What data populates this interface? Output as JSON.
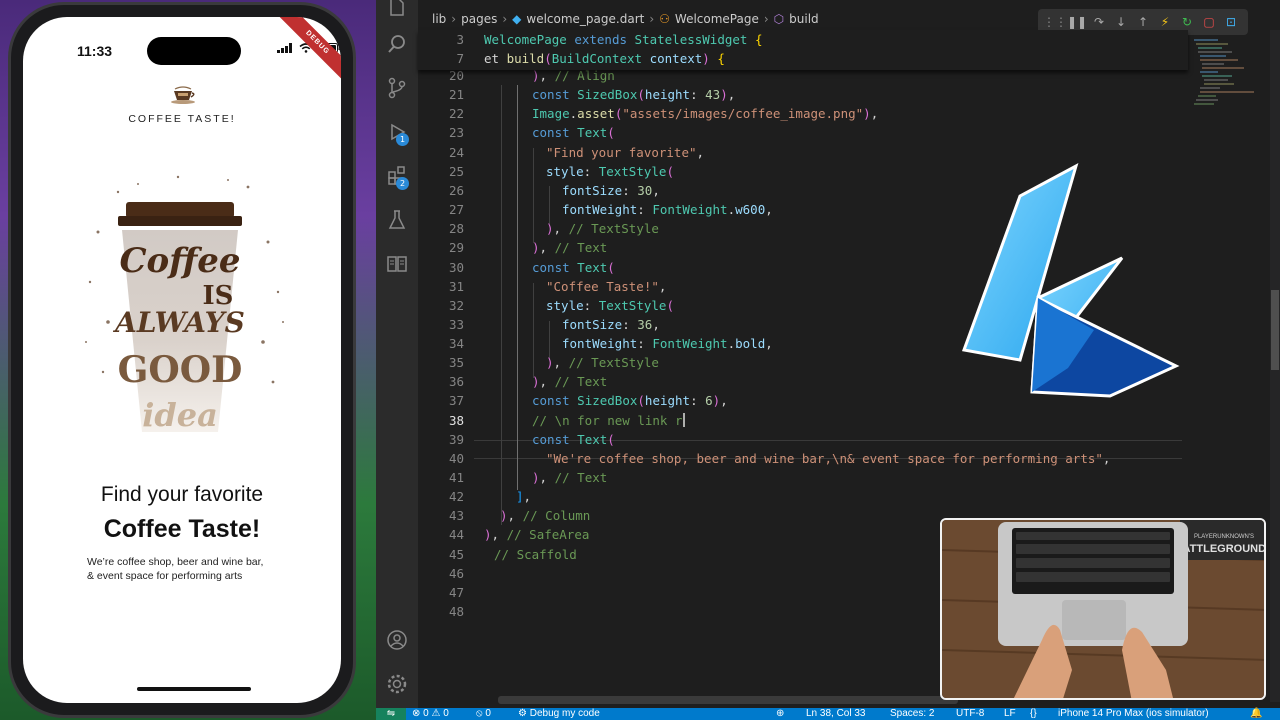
{
  "phone": {
    "time": "11:33",
    "debug_ribbon": "DEBUG",
    "brand": "COFFEE TASTE!",
    "heading_1": "Find your favorite",
    "heading_2": "Coffee Taste!",
    "subtitle_1": "We’re coffee shop, beer and wine bar,",
    "subtitle_2": "& event space for performing arts",
    "art_words": [
      "Coffee",
      "IS",
      "ALWAYS",
      "GOOD",
      "idea"
    ]
  },
  "breadcrumb": {
    "items": [
      "lib",
      "pages",
      "welcome_page.dart",
      "WelcomePage",
      "build"
    ]
  },
  "activity_bar": {
    "badges": [
      "1",
      "2"
    ]
  },
  "editor": {
    "sticky_lines": [
      {
        "num": "3",
        "text": "WelcomePage extends StatelessWidget {"
      },
      {
        "num": "7",
        "text": "et build(BuildContext context) {"
      }
    ],
    "lines": [
      {
        "num": "20",
        "text": "), // Align"
      },
      {
        "num": "21",
        "text": "const SizedBox(height: 43),"
      },
      {
        "num": "22",
        "text": "Image.asset(\"assets/images/coffee_image.png\"),"
      },
      {
        "num": "23",
        "text": "const Text("
      },
      {
        "num": "24",
        "text": "\"Find your favorite\","
      },
      {
        "num": "25",
        "text": "style: TextStyle("
      },
      {
        "num": "26",
        "text": "fontSize: 30,"
      },
      {
        "num": "27",
        "text": "fontWeight: FontWeight.w600,"
      },
      {
        "num": "28",
        "text": "), // TextStyle"
      },
      {
        "num": "29",
        "text": "), // Text"
      },
      {
        "num": "30",
        "text": "const Text("
      },
      {
        "num": "31",
        "text": "\"Coffee Taste!\","
      },
      {
        "num": "32",
        "text": "style: TextStyle("
      },
      {
        "num": "33",
        "text": "fontSize: 36,"
      },
      {
        "num": "34",
        "text": "fontWeight: FontWeight.bold,"
      },
      {
        "num": "35",
        "text": "), // TextStyle"
      },
      {
        "num": "36",
        "text": "), // Text"
      },
      {
        "num": "37",
        "text": "const SizedBox(height: 6),"
      },
      {
        "num": "38",
        "text": "// \\n for new link r"
      },
      {
        "num": "39",
        "text": "const Text("
      },
      {
        "num": "40",
        "text": "\"We're coffee shop, beer and wine bar,\\n& event space for performing arts\","
      },
      {
        "num": "41",
        "text": "), // Text"
      },
      {
        "num": "42",
        "text": "],"
      },
      {
        "num": "43",
        "text": "), // Column"
      },
      {
        "num": "44",
        "text": "), // SafeArea"
      },
      {
        "num": "45",
        "text": "// Scaffold"
      },
      {
        "num": "46",
        "text": ""
      },
      {
        "num": "47",
        "text": ""
      },
      {
        "num": "48",
        "text": ""
      }
    ]
  },
  "statusbar": {
    "errors": "0",
    "warnings": "0",
    "ports": "0",
    "debug": "Debug my code",
    "position": "Ln 38, Col 33",
    "spaces": "Spaces: 2",
    "encoding": "UTF-8",
    "eol": "LF",
    "braces": "{}",
    "device": "iPhone 14 Pro Max (ios simulator)"
  },
  "webcam": {
    "poster_text": "PLAYERUNKNOWN'S BATTLEGROUNDS"
  },
  "colors": {
    "accent": "#007acc",
    "editor_bg": "#1e1e1e",
    "flutter_light": "#5ec8f8",
    "flutter_dark": "#0d47a1",
    "coffee_brown": "#4a2c17"
  }
}
